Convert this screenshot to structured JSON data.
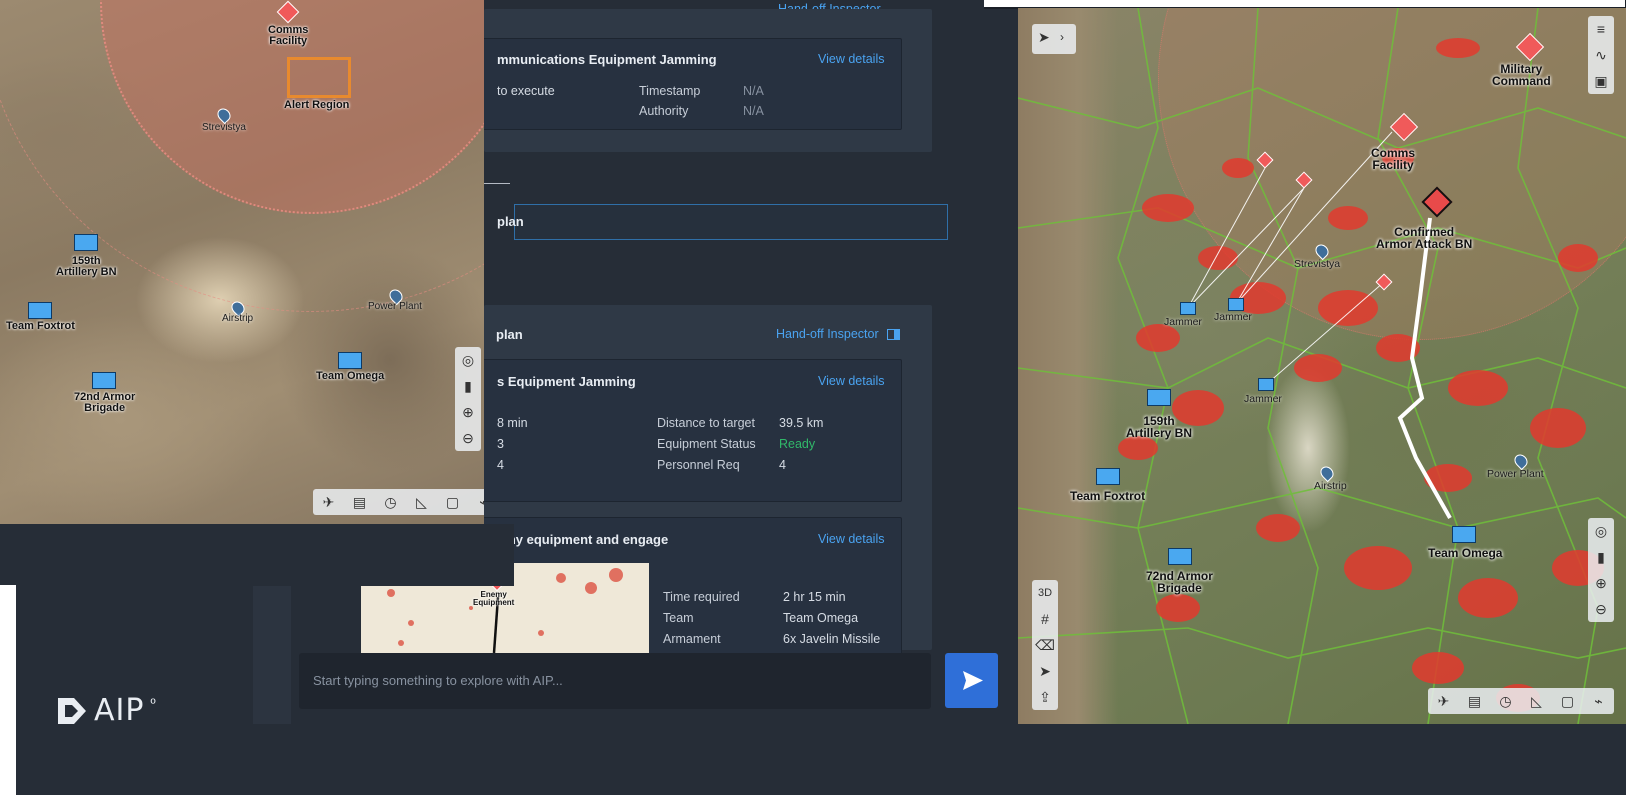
{
  "left_map": {
    "labels": {
      "comms_facility": "Comms\nFacility",
      "alert_region": "Alert Region",
      "strevistya": "Strevistya",
      "artillery": "159th\nArtillery BN",
      "team_foxtrot": "Team Foxtrot",
      "airstrip": "Airstrip",
      "power_plant": "Power Plant",
      "team_omega": "Team Omega",
      "armor_brigade": "72nd Armor\nBrigade"
    }
  },
  "middle": {
    "top_header_link": "Hand-off Inspector",
    "card1": {
      "title": "mmunications Equipment Jamming",
      "view": "View details",
      "left_text": "to execute",
      "k1": "Timestamp",
      "v1": "N/A",
      "k2": "Authority",
      "v2": "N/A"
    },
    "dash": "——",
    "plan_field": "plan",
    "plan_section": {
      "title": "plan",
      "hand_off": "Hand-off Inspector",
      "card2": {
        "title": "s Equipment Jamming",
        "view": "View details",
        "l1": "8 min",
        "l2": "3",
        "l3": "4",
        "k1": "Distance to target",
        "v1": "39.5 km",
        "k2": "Equipment Status",
        "v2": "Ready",
        "k3": "Personnel Req",
        "v3": "4"
      },
      "card3": {
        "title": "emy equipment and engage",
        "view": "View details",
        "k1": "Time required",
        "v1": "2 hr 15 min",
        "k2": "Team",
        "v2": "Team Omega",
        "k3": "Armament",
        "v3": "6x Javelin Missile",
        "mini_label": "Enemy\nEquipment"
      }
    },
    "chat": {
      "placeholder": "Start typing something to explore with AIP..."
    }
  },
  "right_map": {
    "labels": {
      "military_command": "Military\nCommand",
      "comms_facility": "Comms\nFacility",
      "confirmed": "Confirmed\nArmor Attack BN",
      "strevistya": "Strevistya",
      "jammer1": "Jammer",
      "jammer2": "Jammer",
      "jammer3": "Jammer",
      "artillery": "159th\nArtillery BN",
      "team_foxtrot": "Team Foxtrot",
      "airstrip": "Airstrip",
      "power_plant": "Power Plant",
      "team_omega": "Team Omega",
      "armor_brigade": "72nd Armor\nBrigade",
      "btn_3d": "3D"
    }
  },
  "logo": {
    "text": "AIP"
  },
  "colors": {
    "accent": "#2f6fd8",
    "link": "#4aa3f0",
    "ready": "#31b86a",
    "unit": "#4aa8f0",
    "enemy": "#f05a5a"
  }
}
